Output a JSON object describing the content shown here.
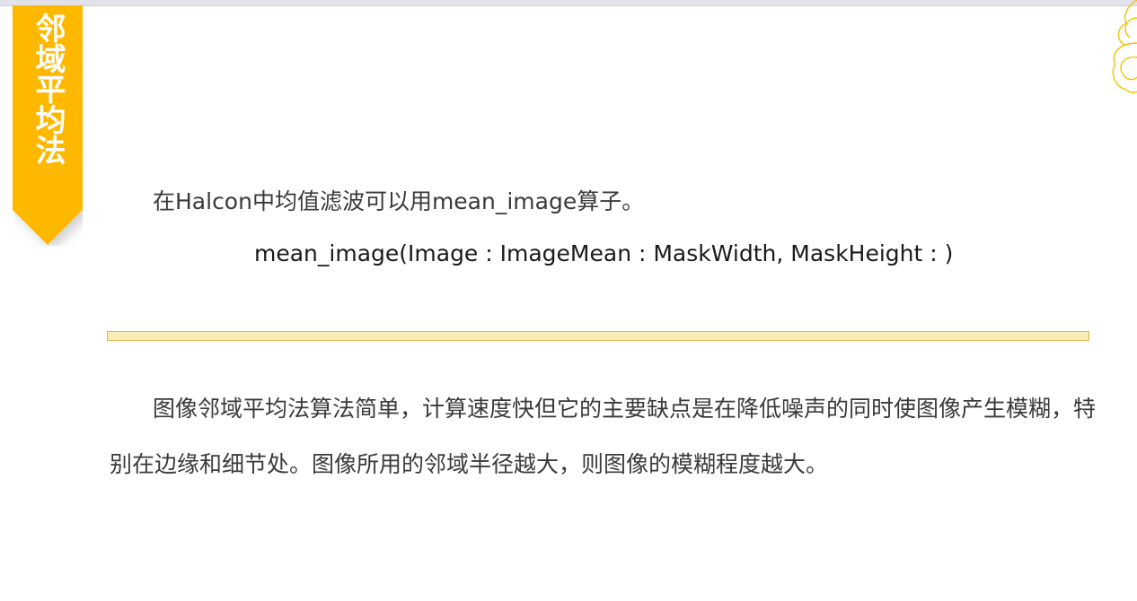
{
  "ribbon": {
    "title": "邻域平均法",
    "color": "#ffb800"
  },
  "content": {
    "intro": "在Halcon中均值滤波可以用mean_image算子。",
    "signature": "mean_image(Image : ImageMean : MaskWidth, MaskHeight : )",
    "paragraph": "图像邻域平均法算法简单，计算速度快但它的主要缺点是在降低噪声的同时使图像产生模糊，特别在边缘和细节处。图像所用的邻域半径越大，则图像的模糊程度越大。"
  },
  "colors": {
    "accent": "#ffb800",
    "divider_fill": "#fbebb7",
    "divider_border": "#e0b54a",
    "text": "#3a3a3a"
  }
}
